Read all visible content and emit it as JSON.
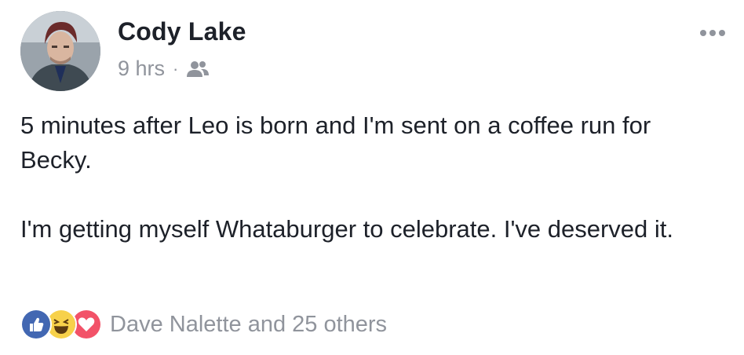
{
  "post": {
    "author": "Cody Lake",
    "timestamp": "9 hrs",
    "separator": "·",
    "audience_icon": "friends-icon",
    "paragraphs": [
      "5 minutes after Leo is born and I'm sent on a coffee run for Becky.",
      "I'm getting myself Whataburger to celebrate. I've deserved it."
    ],
    "reactions": {
      "icons": [
        "like-icon",
        "haha-icon",
        "love-icon"
      ],
      "summary": "Dave Nalette and 25 others"
    }
  },
  "colors": {
    "text": "#1d2129",
    "meta": "#90949c",
    "like": "#4267b2",
    "haha": "#f7d14a",
    "love": "#f25268"
  }
}
